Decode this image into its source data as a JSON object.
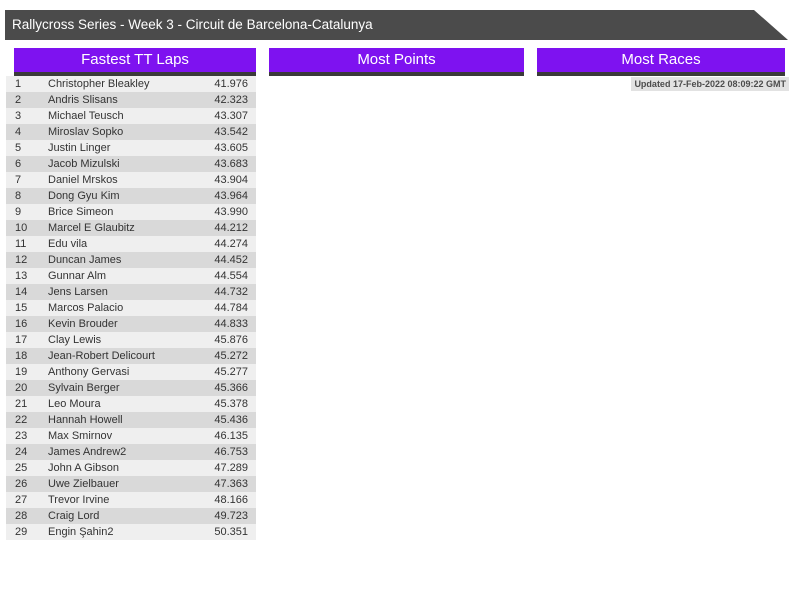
{
  "title_bar": {
    "text": "Rallycross Series - Week 3 - Circuit de Barcelona-Catalunya"
  },
  "sections": [
    {
      "title": "Fastest TT Laps"
    },
    {
      "title": "Most Points"
    },
    {
      "title": "Most Races"
    }
  ],
  "updated": {
    "text": "Updated 17-Feb-2022 08:09:22 GMT"
  },
  "fastest_tt_laps": {
    "rows": [
      {
        "rank": "1",
        "name": "Christopher Bleakley",
        "time": "41.976"
      },
      {
        "rank": "2",
        "name": "Andris Slisans",
        "time": "42.323"
      },
      {
        "rank": "3",
        "name": "Michael Teusch",
        "time": "43.307"
      },
      {
        "rank": "4",
        "name": "Miroslav Sopko",
        "time": "43.542"
      },
      {
        "rank": "5",
        "name": "Justin Linger",
        "time": "43.605"
      },
      {
        "rank": "6",
        "name": "Jacob Mizulski",
        "time": "43.683"
      },
      {
        "rank": "7",
        "name": "Daniel Mrskos",
        "time": "43.904"
      },
      {
        "rank": "8",
        "name": "Dong Gyu Kim",
        "time": "43.964"
      },
      {
        "rank": "9",
        "name": "Brice Simeon",
        "time": "43.990"
      },
      {
        "rank": "10",
        "name": "Marcel E Glaubitz",
        "time": "44.212"
      },
      {
        "rank": "11",
        "name": "Edu vila",
        "time": "44.274"
      },
      {
        "rank": "12",
        "name": "Duncan James",
        "time": "44.452"
      },
      {
        "rank": "13",
        "name": "Gunnar Alm",
        "time": "44.554"
      },
      {
        "rank": "14",
        "name": "Jens Larsen",
        "time": "44.732"
      },
      {
        "rank": "15",
        "name": "Marcos Palacio",
        "time": "44.784"
      },
      {
        "rank": "16",
        "name": "Kevin Brouder",
        "time": "44.833"
      },
      {
        "rank": "17",
        "name": "Clay Lewis",
        "time": "45.876"
      },
      {
        "rank": "18",
        "name": "Jean-Robert Delicourt",
        "time": "45.272"
      },
      {
        "rank": "19",
        "name": "Anthony Gervasi",
        "time": "45.277"
      },
      {
        "rank": "20",
        "name": "Sylvain Berger",
        "time": "45.366"
      },
      {
        "rank": "21",
        "name": "Leo Moura",
        "time": "45.378"
      },
      {
        "rank": "22",
        "name": "Hannah Howell",
        "time": "45.436"
      },
      {
        "rank": "23",
        "name": "Max Smirnov",
        "time": "46.135"
      },
      {
        "rank": "24",
        "name": "James Andrew2",
        "time": "46.753"
      },
      {
        "rank": "25",
        "name": "John A Gibson",
        "time": "47.289"
      },
      {
        "rank": "26",
        "name": "Uwe Zielbauer",
        "time": "47.363"
      },
      {
        "rank": "27",
        "name": "Trevor Irvine",
        "time": "48.166"
      },
      {
        "rank": "28",
        "name": "Craig Lord",
        "time": "49.723"
      },
      {
        "rank": "29",
        "name": "Engin Şahin2",
        "time": "50.351"
      }
    ]
  },
  "colors": {
    "accent_purple": "#7e12f0",
    "title_bar_gray": "#4b4b4b",
    "header_shadow": "#3a3a3a",
    "row_light": "#efefef",
    "row_dark": "#d9d9d9",
    "updated_bg": "#e2e2e2"
  }
}
